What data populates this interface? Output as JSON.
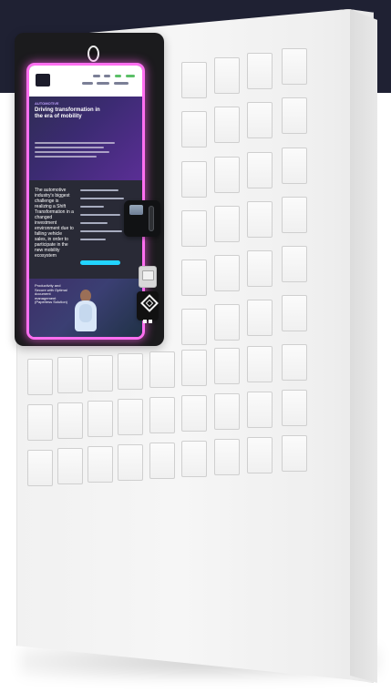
{
  "scene": {
    "subject": "kiosk-locker-cabinet",
    "background_colors": {
      "top_band": "#1f2133",
      "page": "#ffffff",
      "cabinet": "#f3f3f3",
      "screen_glow": "#ff6ff1",
      "hardware": "#111214"
    },
    "icons": [
      "camera-icon",
      "card-reader-icon",
      "printer-icon",
      "nfc-icon"
    ]
  },
  "screen": {
    "hero_kicker": "AUTOMOTIVE",
    "hero_title": "Driving transformation in the era of mobility",
    "content_text": "The automotive industry's biggest challenge is realizing a Shift Transformation in a changed investment environment due to falling vehicle sales, in order to participate in the new mobility ecosystem",
    "person_caption": "Productivity and Secure with Optimal document management (Paperless Solution)"
  }
}
